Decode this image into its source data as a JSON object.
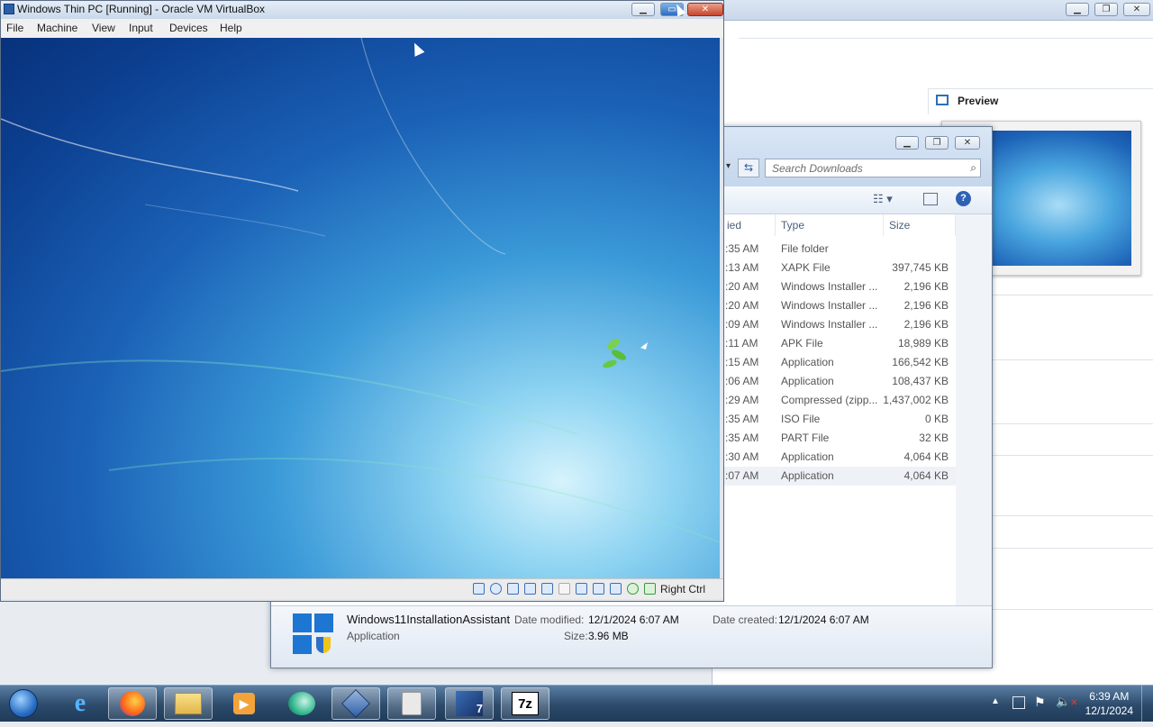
{
  "vm_window": {
    "title": "Windows Thin PC [Running] - Oracle VM VirtualBox",
    "menu": [
      "File",
      "Machine",
      "View",
      "Input",
      "Devices",
      "Help"
    ],
    "host_key": "Right Ctrl"
  },
  "manager": {
    "preview_label": "Preview"
  },
  "explorer": {
    "search_placeholder": "Search Downloads",
    "columns": {
      "date_fragment": "ied",
      "type": "Type",
      "size": "Size"
    },
    "rows": [
      {
        "time": ":35 AM",
        "type": "File folder",
        "size": ""
      },
      {
        "time": ":13 AM",
        "type": "XAPK File",
        "size": "397,745 KB"
      },
      {
        "time": ":20 AM",
        "type": "Windows Installer ...",
        "size": "2,196 KB"
      },
      {
        "time": ":20 AM",
        "type": "Windows Installer ...",
        "size": "2,196 KB"
      },
      {
        "time": ":09 AM",
        "type": "Windows Installer ...",
        "size": "2,196 KB"
      },
      {
        "time": ":11 AM",
        "type": "APK File",
        "size": "18,989 KB"
      },
      {
        "time": ":15 AM",
        "type": "Application",
        "size": "166,542 KB"
      },
      {
        "time": ":06 AM",
        "type": "Application",
        "size": "108,437 KB"
      },
      {
        "time": ":29 AM",
        "type": "Compressed (zipp...",
        "size": "1,437,002 KB"
      },
      {
        "time": ":35 AM",
        "type": "ISO File",
        "size": "0 KB"
      },
      {
        "time": ":35 AM",
        "type": "PART File",
        "size": "32 KB"
      },
      {
        "time": ":30 AM",
        "type": "Application",
        "size": "4,064 KB"
      },
      {
        "time": ":07 AM",
        "type": "Application",
        "size": "4,064 KB"
      }
    ],
    "details": {
      "name": "Windows11InstallationAssistant",
      "kind": "Application",
      "modified_label": "Date modified:",
      "modified": "12/1/2024 6:07 AM",
      "created_label": "Date created:",
      "created": "12/1/2024 6:07 AM",
      "size_label": "Size:",
      "size": "3.96 MB"
    }
  },
  "taskbar": {
    "apps": [
      "start-orb",
      "internet-explorer",
      "firefox",
      "windows-explorer",
      "media-player",
      "browser-app",
      "virtualbox",
      "disk-app",
      "visual-studio",
      "7zip"
    ],
    "label_7z": "7z",
    "time": "6:39 AM",
    "date": "12/1/2024"
  },
  "colors": {
    "accent": "#1b62b7",
    "taskbar": "#2c4a6b",
    "close": "#c8452c"
  }
}
